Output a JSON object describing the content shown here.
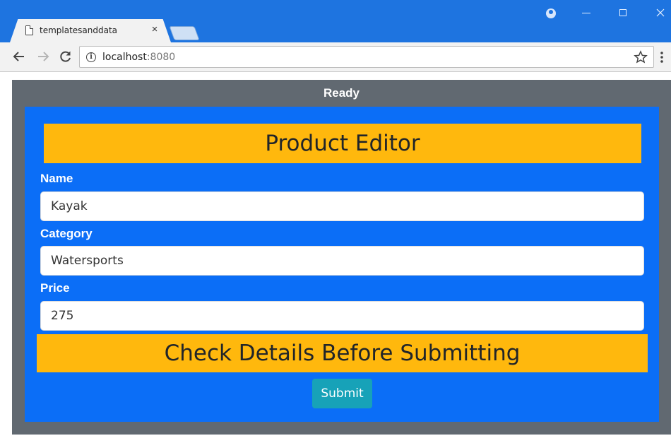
{
  "browser": {
    "tab_title": "templatesanddata",
    "tab_close": "×",
    "url_host": "localhost",
    "url_port": ":8080",
    "icons": {
      "back": "arrow-left-icon",
      "forward": "arrow-right-icon",
      "reload": "reload-icon",
      "info": "info-icon",
      "star": "star-icon",
      "menu": "kebab-menu-icon",
      "profile": "profile-icon",
      "page": "page-icon"
    }
  },
  "app": {
    "status": "Ready",
    "editor_title": "Product Editor",
    "fields": {
      "name_label": "Name",
      "name_value": "Kayak",
      "category_label": "Category",
      "category_value": "Watersports",
      "price_label": "Price",
      "price_value": "275"
    },
    "banner": "Check Details Before Submitting",
    "submit_label": "Submit"
  },
  "colors": {
    "titlebar": "#1e74e0",
    "frame": "#616971",
    "panel": "#0b6ef7",
    "warning": "#ffb80d",
    "submit": "#17a2b8"
  }
}
